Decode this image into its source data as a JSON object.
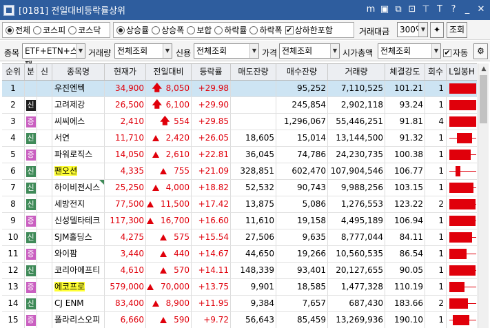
{
  "window": {
    "title": "[0181] 전일대비등락률상위",
    "tools": [
      "m",
      "▣",
      "⧉",
      "⊡",
      "⊤",
      "T",
      "?",
      "_",
      "✕"
    ]
  },
  "toolbar1": {
    "market_options": [
      {
        "label": "전체",
        "selected": true
      },
      {
        "label": "코스피",
        "selected": false
      },
      {
        "label": "코스닥",
        "selected": false
      }
    ],
    "sort_options": [
      {
        "label": "상승률",
        "selected": true
      },
      {
        "label": "상승폭",
        "selected": false
      },
      {
        "label": "보합",
        "selected": false
      },
      {
        "label": "하락률",
        "selected": false
      },
      {
        "label": "하락폭",
        "selected": false
      }
    ],
    "include_limit_label": "상하한포함",
    "include_limit_checked": true,
    "trade_amount_label": "거래대금",
    "trade_amount_value": "300억",
    "query_button": "조회"
  },
  "toolbar2": {
    "item_label": "종목",
    "item_value": "ETF+ETN+스팩",
    "volume_label": "거래량",
    "volume_value": "전체조회",
    "credit_label": "신용",
    "credit_value": "전체조회",
    "price_label": "가격",
    "price_value": "전체조회",
    "mcap_label": "시가총액",
    "mcap_value": "전체조회",
    "auto_label": "자동",
    "auto_checked": true
  },
  "grid": {
    "headers": [
      "순위",
      "분",
      "신",
      "종목명",
      "현재가",
      "전일대비",
      "등락률",
      "매도잔량",
      "매수잔량",
      "거래량",
      "체결강도",
      "회수",
      "L일봉H"
    ],
    "rows": [
      {
        "rank": "1",
        "type": "",
        "name": "우진엔텍",
        "price": "34,900",
        "arrow": "limit",
        "change": "8,050",
        "rate": "+29.98",
        "ask": "",
        "bid": "95,252",
        "volume": "7,110,525",
        "strength": "101.21",
        "count": "1",
        "selected": true,
        "highlight": false,
        "candle": {
          "body": [
            0.08,
            0.98
          ],
          "line": [
            0.08,
            0.98
          ]
        }
      },
      {
        "rank": "2",
        "type": "b",
        "type_label": "신",
        "name": "고려제강",
        "price": "26,500",
        "arrow": "limit",
        "change": "6,100",
        "rate": "+29.90",
        "ask": "",
        "bid": "245,854",
        "volume": "2,902,118",
        "strength": "93.24",
        "count": "1",
        "selected": false,
        "highlight": false,
        "candle": {
          "body": [
            0.08,
            0.98
          ],
          "line": [
            0.08,
            0.98
          ]
        }
      },
      {
        "rank": "3",
        "type": "p",
        "type_label": "증",
        "name": "씨씨에스",
        "price": "2,410",
        "arrow": "limit",
        "change": "554",
        "rate": "+29.85",
        "ask": "",
        "bid": "1,296,067",
        "volume": "55,446,251",
        "strength": "91.81",
        "count": "4",
        "selected": false,
        "highlight": false,
        "candle": {
          "body": [
            0.08,
            0.98
          ],
          "line": [
            0.08,
            0.98
          ]
        }
      },
      {
        "rank": "4",
        "type": "s",
        "type_label": "신",
        "name": "서연",
        "price": "11,710",
        "arrow": "up",
        "change": "2,420",
        "rate": "+26.05",
        "ask": "18,605",
        "bid": "15,014",
        "volume": "13,144,500",
        "strength": "91.32",
        "count": "1",
        "selected": false,
        "highlight": false,
        "candle": {
          "body": [
            0.35,
            0.85
          ],
          "line": [
            0.08,
            0.98
          ]
        }
      },
      {
        "rank": "5",
        "type": "p",
        "type_label": "증",
        "name": "파워로직스",
        "price": "14,050",
        "arrow": "up",
        "change": "2,610",
        "rate": "+22.81",
        "ask": "36,045",
        "bid": "74,786",
        "volume": "24,230,735",
        "strength": "100.38",
        "count": "1",
        "selected": false,
        "highlight": false,
        "candle": {
          "body": [
            0.08,
            0.8
          ],
          "line": [
            0.08,
            0.98
          ]
        }
      },
      {
        "rank": "6",
        "type": "s",
        "type_label": "신",
        "name": "팬오션",
        "price": "4,335",
        "arrow": "up",
        "change": "755",
        "rate": "+21.09",
        "ask": "328,851",
        "bid": "602,470",
        "volume": "107,904,546",
        "strength": "106.77",
        "count": "1",
        "selected": false,
        "highlight": true,
        "candle": {
          "body": [
            0.3,
            0.45
          ],
          "line": [
            0.08,
            0.98
          ]
        }
      },
      {
        "rank": "7",
        "type": "s",
        "type_label": "신",
        "name": "하이비젼시스",
        "price": "25,250",
        "arrow": "up",
        "change": "4,000",
        "rate": "+18.82",
        "ask": "52,532",
        "bid": "90,743",
        "volume": "9,988,256",
        "strength": "103.15",
        "count": "1",
        "selected": false,
        "highlight": false,
        "corner": true,
        "candle": {
          "body": [
            0.1,
            0.88
          ],
          "line": [
            0.08,
            0.98
          ]
        }
      },
      {
        "rank": "8",
        "type": "s",
        "type_label": "신",
        "name": "세방전지",
        "price": "77,500",
        "arrow": "up",
        "change": "11,500",
        "rate": "+17.42",
        "ask": "13,875",
        "bid": "5,086",
        "volume": "1,276,553",
        "strength": "123.22",
        "count": "2",
        "selected": false,
        "highlight": false,
        "candle": {
          "body": [
            0.1,
            0.95
          ],
          "line": [
            0.08,
            0.98
          ]
        }
      },
      {
        "rank": "9",
        "type": "p",
        "type_label": "증",
        "name": "신성델타테크",
        "price": "117,300",
        "arrow": "up",
        "change": "16,700",
        "rate": "+16.60",
        "ask": "11,610",
        "bid": "19,158",
        "volume": "4,495,189",
        "strength": "106.94",
        "count": "1",
        "selected": false,
        "highlight": false,
        "candle": {
          "body": [
            0.08,
            0.95
          ],
          "line": [
            0.08,
            0.98
          ]
        }
      },
      {
        "rank": "10",
        "type": "s",
        "type_label": "신",
        "name": "SJM홀딩스",
        "price": "4,275",
        "arrow": "up",
        "change": "575",
        "rate": "+15.54",
        "ask": "27,506",
        "bid": "9,635",
        "volume": "8,777,044",
        "strength": "84.11",
        "count": "1",
        "selected": false,
        "highlight": false,
        "candle": {
          "body": [
            0.08,
            0.85
          ],
          "line": [
            0.08,
            0.98
          ]
        }
      },
      {
        "rank": "11",
        "type": "p",
        "type_label": "증",
        "name": "와이팜",
        "price": "3,440",
        "arrow": "up",
        "change": "440",
        "rate": "+14.67",
        "ask": "44,650",
        "bid": "19,266",
        "volume": "10,560,535",
        "strength": "86.54",
        "count": "1",
        "selected": false,
        "highlight": false,
        "candle": {
          "body": [
            0.08,
            0.65
          ],
          "line": [
            0.08,
            0.98
          ]
        }
      },
      {
        "rank": "12",
        "type": "s",
        "type_label": "신",
        "name": "코리아에프티",
        "price": "4,610",
        "arrow": "up",
        "change": "570",
        "rate": "+14.11",
        "ask": "148,339",
        "bid": "93,401",
        "volume": "20,127,655",
        "strength": "90.05",
        "count": "1",
        "selected": false,
        "highlight": false,
        "candle": {
          "body": [
            0.08,
            0.96
          ],
          "line": [
            0.08,
            0.98
          ]
        }
      },
      {
        "rank": "13",
        "type": "p",
        "type_label": "증",
        "name": "에코프로",
        "price": "579,000",
        "arrow": "up",
        "change": "70,000",
        "rate": "+13.75",
        "ask": "9,901",
        "bid": "18,585",
        "volume": "1,477,328",
        "strength": "110.19",
        "count": "1",
        "selected": false,
        "highlight": true,
        "candle": {
          "body": [
            0.08,
            0.6
          ],
          "line": [
            0.08,
            0.98
          ]
        }
      },
      {
        "rank": "14",
        "type": "s",
        "type_label": "신",
        "name": "CJ ENM",
        "price": "83,400",
        "arrow": "up",
        "change": "8,900",
        "rate": "+11.95",
        "ask": "9,384",
        "bid": "7,657",
        "volume": "687,430",
        "strength": "183.66",
        "count": "2",
        "selected": false,
        "highlight": false,
        "candle": {
          "body": [
            0.08,
            0.7
          ],
          "line": [
            0.08,
            0.98
          ]
        }
      },
      {
        "rank": "15",
        "type": "p",
        "type_label": "증",
        "name": "폴라리스오피",
        "price": "6,660",
        "arrow": "up",
        "change": "590",
        "rate": "+9.72",
        "ask": "56,643",
        "bid": "85,459",
        "volume": "13,269,936",
        "strength": "190.10",
        "count": "1",
        "selected": false,
        "highlight": false,
        "candle": {
          "body": [
            0.2,
            0.75
          ],
          "line": [
            0.08,
            0.98
          ]
        }
      }
    ]
  }
}
